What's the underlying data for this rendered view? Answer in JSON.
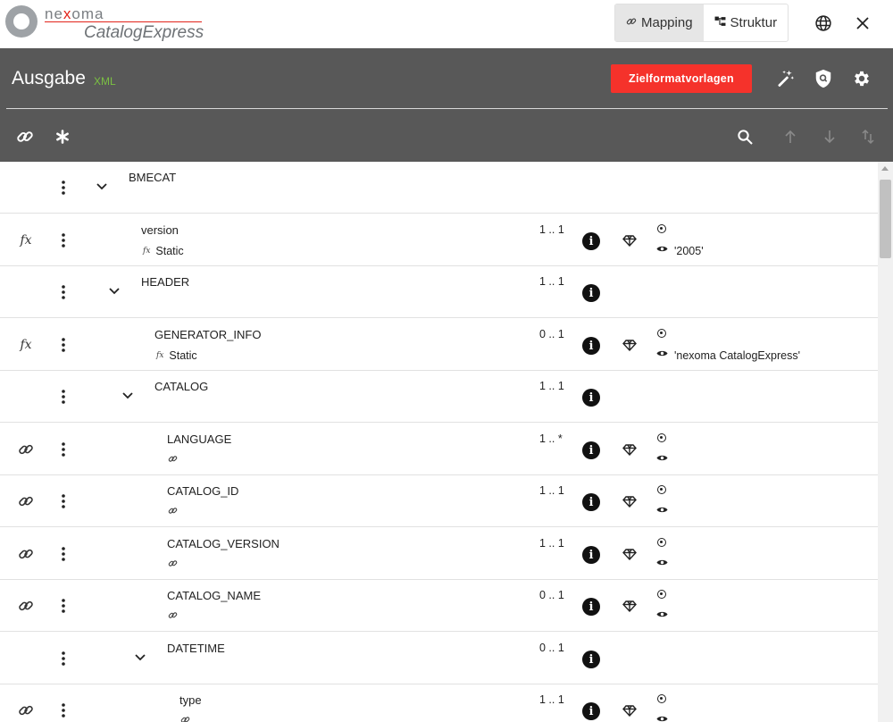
{
  "app": {
    "logo_brand_pre": "ne",
    "logo_brand_x": "x",
    "logo_brand_post": "oma",
    "logo_product": "CatalogExpress"
  },
  "view_toggle": {
    "mapping_label": "Mapping",
    "struktur_label": "Struktur",
    "active": "Mapping"
  },
  "header": {
    "title": "Ausgabe",
    "badge": "XML",
    "button_label": "Zielformatvorlagen",
    "button_color": "#f5322b",
    "background": "#585858"
  },
  "tree": {
    "rows": [
      {
        "name": "BMECAT",
        "cardinality": "",
        "left_icon": "",
        "sub_text": "",
        "sub_icon": "",
        "value": "",
        "expandable": true,
        "show_info": false,
        "show_gem": false,
        "show_radio": false,
        "show_eye": false
      },
      {
        "name": "version",
        "cardinality": "1 .. 1",
        "left_icon": "fx",
        "sub_text": "Static",
        "sub_icon": "fx",
        "value": "'2005'",
        "expandable": false,
        "show_info": true,
        "show_gem": true,
        "show_radio": true,
        "show_eye": true
      },
      {
        "name": "HEADER",
        "cardinality": "1 .. 1",
        "left_icon": "",
        "sub_text": "",
        "sub_icon": "",
        "value": "",
        "expandable": true,
        "show_info": true,
        "show_gem": false,
        "show_radio": false,
        "show_eye": false
      },
      {
        "name": "GENERATOR_INFO",
        "cardinality": "0 .. 1",
        "left_icon": "fx",
        "sub_text": "Static",
        "sub_icon": "fx",
        "value": "'nexoma CatalogExpress'",
        "expandable": false,
        "show_info": true,
        "show_gem": true,
        "show_radio": true,
        "show_eye": true
      },
      {
        "name": "CATALOG",
        "cardinality": "1 .. 1",
        "left_icon": "",
        "sub_text": "",
        "sub_icon": "",
        "value": "",
        "expandable": true,
        "show_info": true,
        "show_gem": false,
        "show_radio": false,
        "show_eye": false
      },
      {
        "name": "LANGUAGE",
        "cardinality": "1 .. *",
        "left_icon": "link",
        "sub_text": "",
        "sub_icon": "link",
        "value": "",
        "expandable": false,
        "show_info": true,
        "show_gem": true,
        "show_radio": true,
        "show_eye": true
      },
      {
        "name": "CATALOG_ID",
        "cardinality": "1 .. 1",
        "left_icon": "link",
        "sub_text": "",
        "sub_icon": "link",
        "value": "",
        "expandable": false,
        "show_info": true,
        "show_gem": true,
        "show_radio": true,
        "show_eye": true
      },
      {
        "name": "CATALOG_VERSION",
        "cardinality": "1 .. 1",
        "left_icon": "link",
        "sub_text": "",
        "sub_icon": "link",
        "value": "",
        "expandable": false,
        "show_info": true,
        "show_gem": true,
        "show_radio": true,
        "show_eye": true
      },
      {
        "name": "CATALOG_NAME",
        "cardinality": "0 .. 1",
        "left_icon": "link",
        "sub_text": "",
        "sub_icon": "link",
        "value": "",
        "expandable": false,
        "show_info": true,
        "show_gem": true,
        "show_radio": true,
        "show_eye": true
      },
      {
        "name": "DATETIME",
        "cardinality": "0 .. 1",
        "left_icon": "",
        "sub_text": "",
        "sub_icon": "",
        "value": "",
        "expandable": true,
        "show_info": true,
        "show_gem": false,
        "show_radio": false,
        "show_eye": false
      },
      {
        "name": "type",
        "cardinality": "1 .. 1",
        "left_icon": "link",
        "sub_text": "",
        "sub_icon": "link",
        "value": "",
        "expandable": false,
        "show_info": true,
        "show_gem": true,
        "show_radio": true,
        "show_eye": true
      }
    ]
  }
}
